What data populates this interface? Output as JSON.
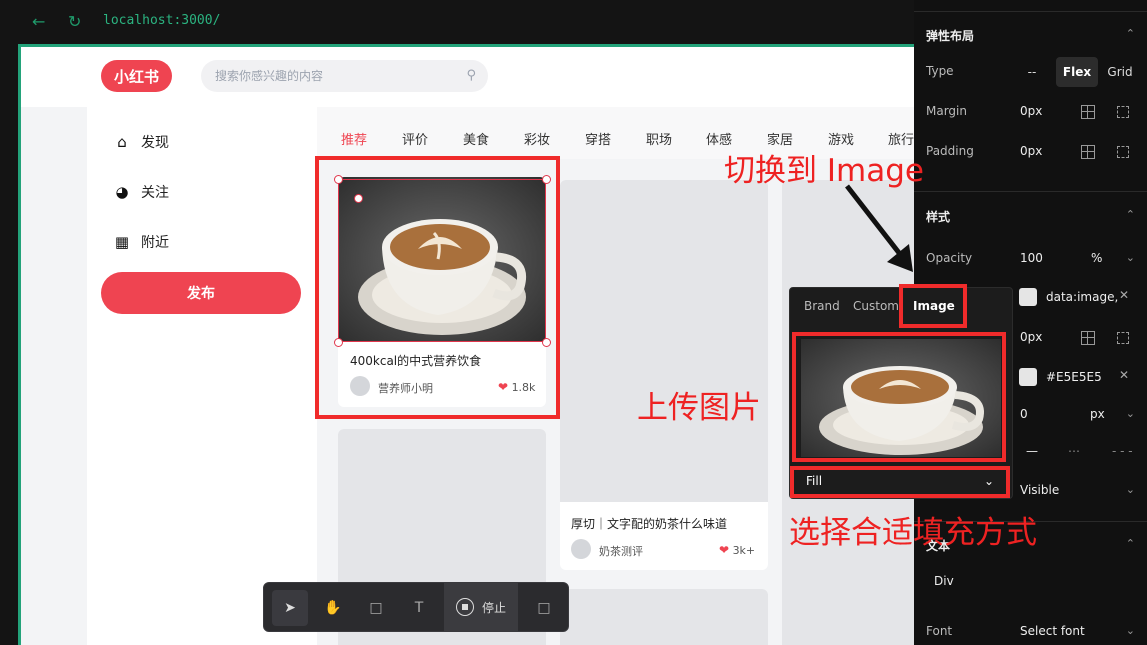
{
  "browser": {
    "url": "localhost:3000/",
    "back_icon": "arrow-left-icon",
    "reload_icon": "reload-icon"
  },
  "site": {
    "logo": "小红书",
    "search_placeholder": "搜索你感兴趣的内容",
    "sidebar": [
      {
        "label": "发现",
        "icon": "home-icon"
      },
      {
        "label": "关注",
        "icon": "compass-icon"
      },
      {
        "label": "附近",
        "icon": "grid-icon"
      }
    ],
    "publish_label": "发布",
    "tabs": [
      "推荐",
      "评价",
      "美食",
      "彩妆",
      "穿搭",
      "职场",
      "体感",
      "家居",
      "游戏",
      "旅行"
    ],
    "cards": [
      {
        "title": "400kcal的中式营养饮食",
        "author": "营养师小明",
        "likes": "1.8k"
      },
      {
        "title": "厚切｜文字配的奶茶什么味道",
        "author": "奶茶测评",
        "likes": "3k+"
      }
    ]
  },
  "toolbar": {
    "stop_label": "停止",
    "tools": [
      "pointer-icon",
      "hand-icon",
      "rectangle-icon",
      "text-icon",
      "stop-icon",
      "terminal-icon"
    ]
  },
  "panel": {
    "layout_title": "弹性布局",
    "type_label": "Type",
    "type_options": [
      "--",
      "Flex",
      "Grid"
    ],
    "margin_label": "Margin",
    "margin_value": "0px",
    "padding_label": "Padding",
    "padding_value": "0px",
    "style_title": "样式",
    "opacity_label": "Opacity",
    "opacity_value": "100",
    "opacity_unit": "%",
    "bg_value": "data:image,",
    "radius_value": "0px",
    "border_color": "#E5E5E5",
    "border_width": "0",
    "border_unit": "px",
    "overflow_value": "Visible",
    "text_title": "文本",
    "text_tag": "Div",
    "font_label": "Font",
    "font_value": "Select font"
  },
  "popover": {
    "tabs": [
      "Brand",
      "Custom",
      "Image"
    ],
    "fill_value": "Fill"
  },
  "annotations": {
    "switch": "切换到 Image",
    "upload": "上传图片",
    "fill": "选择合适填充方式"
  },
  "colors": {
    "brand": "#EF4451",
    "annotation": "#F02B2B",
    "frame_border": "#23A37A"
  }
}
